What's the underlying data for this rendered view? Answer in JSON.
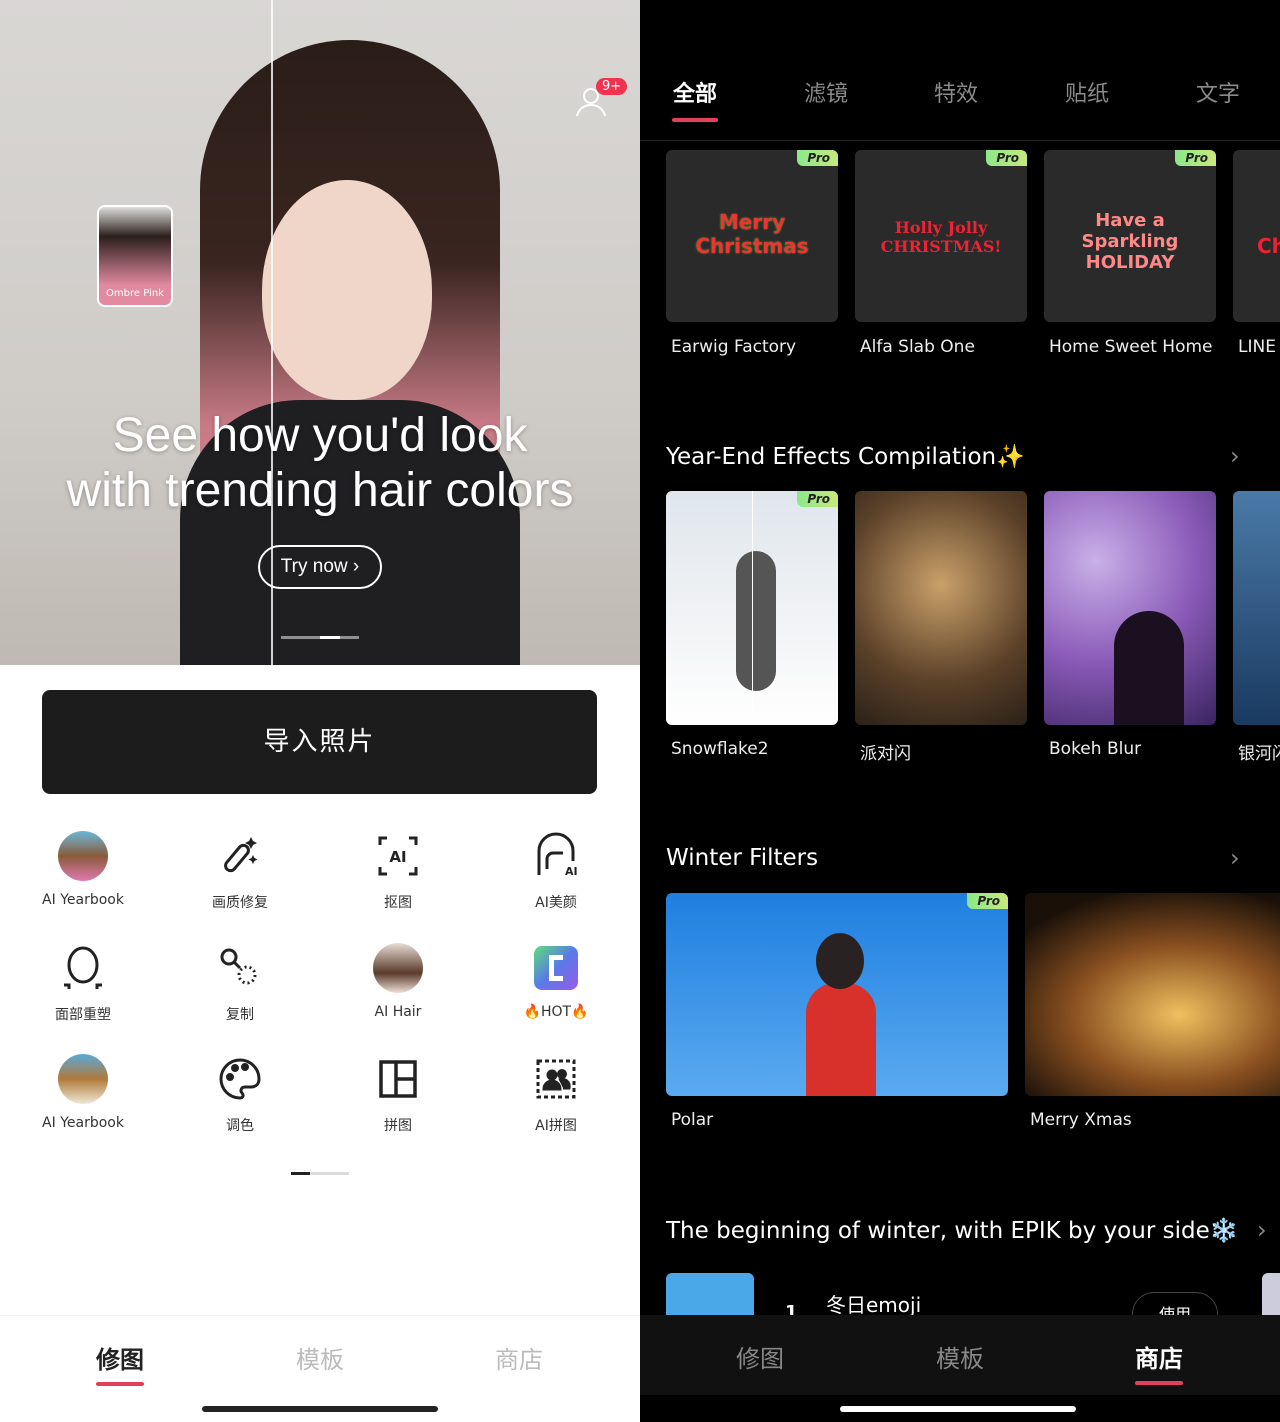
{
  "left": {
    "hero": {
      "title_line1": "See how you'd look",
      "title_line2": "with trending hair colors",
      "cta": "Try now ›",
      "thumb_label": "Ombre Pink",
      "notification_badge": "9+"
    },
    "import_button": "导入照片",
    "tools": [
      {
        "label": "AI Yearbook",
        "icon": "avatar-photo"
      },
      {
        "label": "画质修复",
        "icon": "magic-wand-icon"
      },
      {
        "label": "抠图",
        "icon": "ai-cutout-icon"
      },
      {
        "label": "AI美颜",
        "icon": "ai-beauty-icon"
      },
      {
        "label": "面部重塑",
        "icon": "face-reshape-icon"
      },
      {
        "label": "复制",
        "icon": "clone-icon"
      },
      {
        "label": "AI Hair",
        "icon": "avatar-photo"
      },
      {
        "label": "🔥HOT🔥",
        "icon": "app-logo-icon"
      },
      {
        "label": "AI Yearbook",
        "icon": "avatar-photo"
      },
      {
        "label": "调色",
        "icon": "palette-icon"
      },
      {
        "label": "拼图",
        "icon": "collage-icon"
      },
      {
        "label": "AI拼图",
        "icon": "ai-collage-icon"
      }
    ],
    "nav": [
      {
        "label": "修图",
        "active": true
      },
      {
        "label": "模板",
        "active": false
      },
      {
        "label": "商店",
        "active": false
      }
    ]
  },
  "right": {
    "tabs": [
      {
        "label": "全部",
        "active": true
      },
      {
        "label": "滤镜"
      },
      {
        "label": "特效"
      },
      {
        "label": "贴纸"
      },
      {
        "label": "文字"
      }
    ],
    "fonts": [
      {
        "name": "Earwig Factory",
        "preview": "Merry Christmas",
        "pro": "Pro"
      },
      {
        "name": "Alfa Slab One",
        "preview": "Holly Jolly CHRISTMAS!",
        "pro": "Pro"
      },
      {
        "name": "Home Sweet Home",
        "preview": "Have a Sparkling HOLIDAY",
        "pro": "Pro"
      },
      {
        "name": "LINE",
        "preview": "Ch"
      }
    ],
    "section1": {
      "title": "Year-End Effects Compilation✨",
      "items": [
        {
          "name": "Snowflake2",
          "pro": "Pro"
        },
        {
          "name": "派对闪"
        },
        {
          "name": "Bokeh Blur"
        },
        {
          "name": "银河闪"
        }
      ]
    },
    "section2": {
      "title": "Winter Filters",
      "items": [
        {
          "name": "Polar",
          "pro": "Pro"
        },
        {
          "name": "Merry Xmas"
        }
      ]
    },
    "section3": {
      "title": "The beginning of winter, with EPIK by your side❄️",
      "item": {
        "name": "冬日emoji",
        "rank": "1",
        "button": "使用"
      }
    },
    "nav": [
      {
        "label": "修图",
        "active": false
      },
      {
        "label": "模板",
        "active": false
      },
      {
        "label": "商店",
        "active": true
      }
    ]
  },
  "colors": {
    "accent": "#e0405c",
    "pro_badge": "#a6e884",
    "dark_button": "#1c1c1c"
  }
}
